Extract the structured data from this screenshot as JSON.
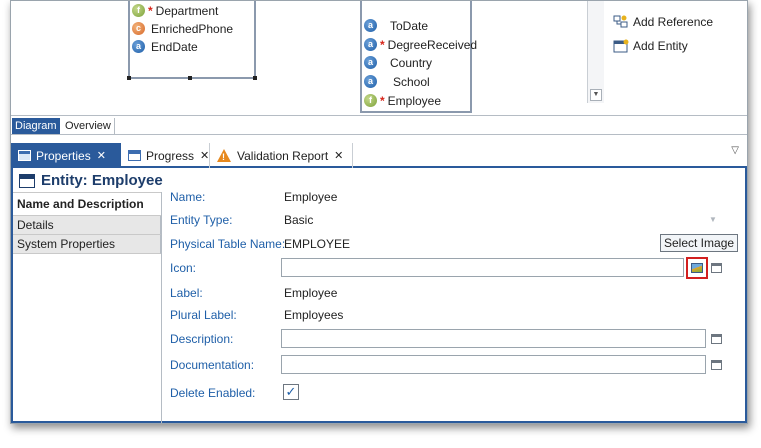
{
  "diagram": {
    "left_entity": {
      "rows": [
        {
          "icon": "foreign-key-icon",
          "required": true,
          "label": "Department"
        },
        {
          "icon": "calculated-attribute-icon",
          "required": false,
          "label": "EnrichedPhone"
        },
        {
          "icon": "attribute-icon",
          "required": false,
          "label": "EndDate"
        }
      ]
    },
    "middle_entity": {
      "rows": [
        {
          "icon": "attribute-icon",
          "required": false,
          "label": "ToDate"
        },
        {
          "icon": "attribute-icon",
          "required": true,
          "label": "DegreeReceived"
        },
        {
          "icon": "attribute-icon",
          "required": false,
          "label": "Country"
        },
        {
          "icon": "attribute-icon",
          "required": false,
          "label": "School"
        },
        {
          "icon": "foreign-key-icon",
          "required": true,
          "label": "Employee"
        }
      ]
    },
    "palette": [
      {
        "icon": "add-reference-icon",
        "label": "Add Reference"
      },
      {
        "icon": "add-entity-icon",
        "label": "Add Entity"
      }
    ],
    "tabs": {
      "diagram": "Diagram",
      "overview": "Overview"
    }
  },
  "view_tabs": {
    "properties": "Properties",
    "progress": "Progress",
    "validation_report": "Validation Report",
    "close_glyph": "✕"
  },
  "properties": {
    "title": "Entity: Employee",
    "side_tabs": [
      "Name and Description",
      "Details",
      "System Properties"
    ],
    "fields": {
      "name": {
        "label": "Name:",
        "value": "Employee"
      },
      "entity_type": {
        "label": "Entity Type:",
        "value": "Basic"
      },
      "physical_table_name": {
        "label": "Physical Table Name:",
        "value": "EMPLOYEE"
      },
      "icon": {
        "label": "Icon:",
        "value": ""
      },
      "label": {
        "label": "Label:",
        "value": "Employee"
      },
      "plural_label": {
        "label": "Plural Label:",
        "value": "Employees"
      },
      "description": {
        "label": "Description:",
        "value": ""
      },
      "documentation": {
        "label": "Documentation:",
        "value": ""
      },
      "delete_enabled": {
        "label": "Delete Enabled:",
        "checked": true
      }
    },
    "tooltip": "Select Image"
  },
  "colors": {
    "accent": "#2a5a9b",
    "label_blue": "#1f5fa8",
    "highlight_red": "#d21f1f",
    "warning": "#e7891e"
  }
}
